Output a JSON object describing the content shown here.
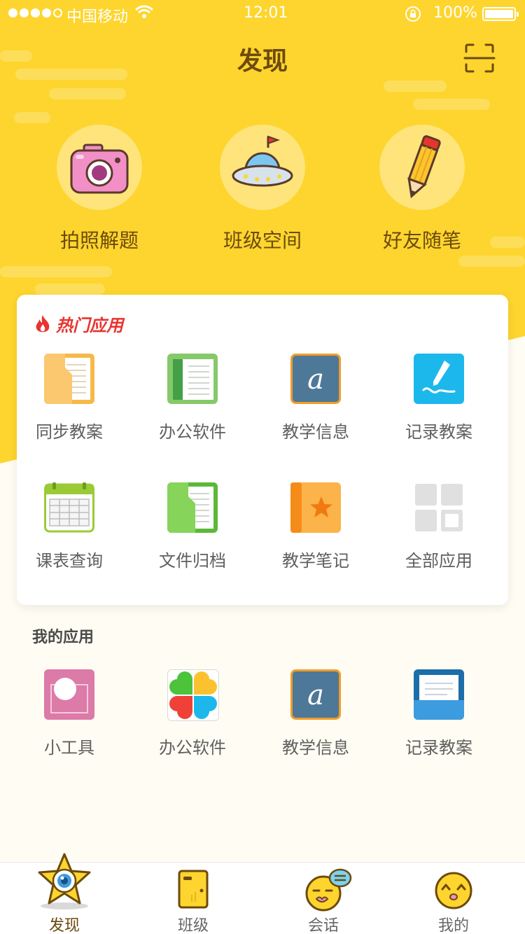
{
  "status_bar": {
    "carrier": "中国移动",
    "time": "12:01",
    "battery": "100%"
  },
  "nav": {
    "title": "发现",
    "scan_icon": "scan-frame-icon"
  },
  "features": [
    {
      "label": "拍照解题",
      "icon": "camera-icon"
    },
    {
      "label": "班级空间",
      "icon": "ufo-icon"
    },
    {
      "label": "好友随笔",
      "icon": "pencil-icon"
    }
  ],
  "hot_apps": {
    "title": "热门应用",
    "items": [
      {
        "label": "同步教案",
        "icon": "book-folder-icon"
      },
      {
        "label": "办公软件",
        "icon": "green-book-icon"
      },
      {
        "label": "教学信息",
        "icon": "letter-a-icon"
      },
      {
        "label": "记录教案",
        "icon": "pen-note-icon"
      },
      {
        "label": "课表查询",
        "icon": "calendar-icon"
      },
      {
        "label": "文件归档",
        "icon": "file-folder-icon"
      },
      {
        "label": "教学笔记",
        "icon": "star-notebook-icon"
      },
      {
        "label": "全部应用",
        "icon": "grid-icon"
      }
    ]
  },
  "my_apps": {
    "title": "我的应用",
    "items": [
      {
        "label": "小工具",
        "icon": "tool-card-icon"
      },
      {
        "label": "办公软件",
        "icon": "clover-icon"
      },
      {
        "label": "教学信息",
        "icon": "letter-a-icon"
      },
      {
        "label": "记录教案",
        "icon": "document-tray-icon"
      }
    ]
  },
  "tabs": [
    {
      "label": "发现",
      "icon": "star-eye-icon",
      "active": true
    },
    {
      "label": "班级",
      "icon": "door-icon",
      "active": false
    },
    {
      "label": "会话",
      "icon": "chat-face-icon",
      "active": false
    },
    {
      "label": "我的",
      "icon": "smiley-icon",
      "active": false
    }
  ],
  "colors": {
    "brand_yellow": "#fdd52e",
    "title_brown": "#6d4a0c",
    "hot_red": "#e8342f"
  }
}
